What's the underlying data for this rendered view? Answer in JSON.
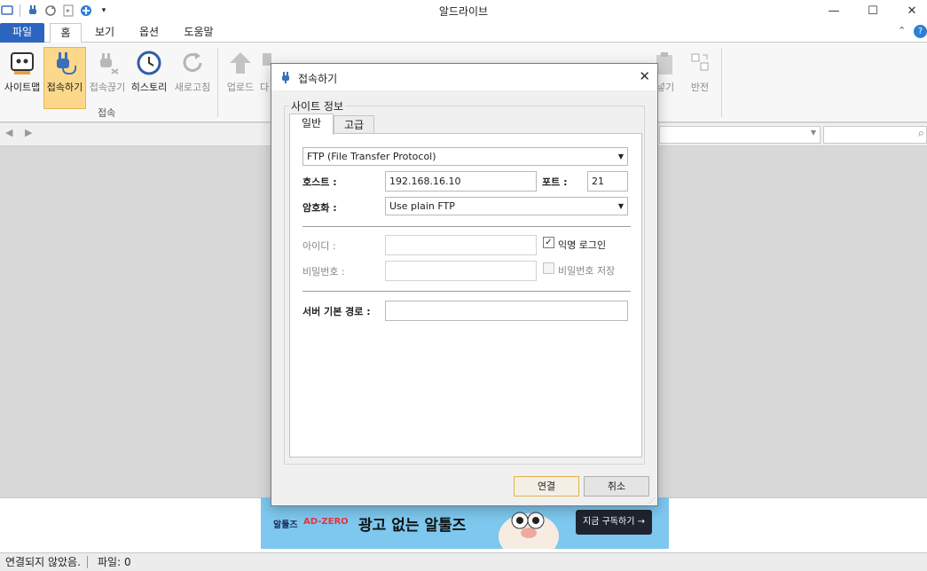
{
  "window": {
    "title": "알드라이브"
  },
  "ribbon_tabs": [
    {
      "label": "파일"
    },
    {
      "label": "홈"
    },
    {
      "label": "보기"
    },
    {
      "label": "옵션"
    },
    {
      "label": "도움말"
    }
  ],
  "ribbon_buttons": {
    "sitemap": "사이트맵",
    "connect": "접속하기",
    "disconnect": "접속끊기",
    "history": "히스토리",
    "refresh": "새로고침",
    "upload": "업로드",
    "download_partial": "다",
    "paste_partial": "넣기",
    "invert": "반전"
  },
  "ribbon_group": {
    "connection": "접속"
  },
  "dialog": {
    "title": "접속하기",
    "group_title": "사이트 정보",
    "tabs": [
      {
        "label": "일반"
      },
      {
        "label": "고급"
      }
    ],
    "protocol": "FTP (File Transfer Protocol)",
    "host_label": "호스트 :",
    "host_value": "192.168.16.10",
    "port_label": "포트 :",
    "port_value": "21",
    "encryption_label": "암호화 :",
    "encryption_value": "Use plain FTP",
    "id_label": "아이디 :",
    "anonymous_label": "익명 로그인",
    "anonymous_checked": true,
    "password_label": "비밀번호 :",
    "save_password_label": "비밀번호 저장",
    "save_password_checked": false,
    "server_path_label": "서버 기본 경로 :",
    "server_path_value": "",
    "connect_button": "연결",
    "cancel_button": "취소"
  },
  "ad": {
    "brand": "알툴즈",
    "product": "AD-ZERO",
    "headline": "광고 없는 알툴즈",
    "cta": "지금 구독하기 →"
  },
  "status": {
    "connection": "연결되지 않았음.",
    "files": "파일: 0"
  },
  "colors": {
    "file_tab": "#2b65c0",
    "ad_background": "#7ec8ef",
    "ad_accent": "#e8343a",
    "selected_button": "#fcd98a"
  }
}
